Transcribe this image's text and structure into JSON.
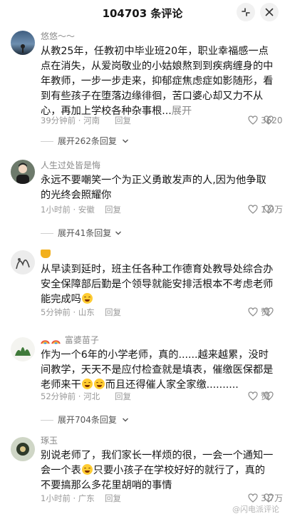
{
  "header": {
    "title": "104703 条评论"
  },
  "comments": [
    {
      "name": "悠悠～～",
      "text": "从教25年，任教初中毕业班20年，职业幸福感一点点在消失，从爱岗敬业的小姑娘熬到到疾病缠身的中年教师，一步一步走来，抑郁症焦虑症如影随形，看到有些孩子在堕落边缘徘徊，苦口婆心却又力不从心，再加上学校各种杂事根...",
      "more": "展开",
      "time": "39分钟前 · 河南",
      "reply": "回复",
      "likes": "3620",
      "expand": "展开262条回复"
    },
    {
      "name": "人生过处皆是悔",
      "text": "永远不要嘲笑一个为正义勇敢发声的人,因为他争取的光终会照耀你",
      "time": "1小时前 · 安徽",
      "reply": "回复",
      "likes": "1.0万",
      "expand": "展开41条回复"
    },
    {
      "name": "",
      "text_a": "从早读到延时，班主任各种工作德育处教导处综合办安全保障部后勤是个领导就能安排活根本不考虑老师能完成吗",
      "time": "5分钟前 · 山东",
      "reply": "回复",
      "likes": "赞"
    },
    {
      "name": "富婆苗子",
      "text_a": "作为一个6年的小学老师，真的......越来越累，没时间教学，天天不是应付检查就是填表，催缴医保都是老师来干",
      "text_b": "而且还得催人家全家缴..........",
      "time": "52分钟前 · 河北",
      "reply": "回复",
      "likes": "赞",
      "expand": "展开704条回复"
    },
    {
      "name": "琢玉",
      "text_a": "别说老师了，我们家长一样烦的很，一会一个通知一会一个表",
      "text_b": "只要小孩子在学校好好的就行了，真的不要搞那么多花里胡哨的事情",
      "time": "1小时前 · 广东",
      "reply": "回复",
      "likes": "3.7万"
    }
  ],
  "watermark": "@闪电派评论"
}
